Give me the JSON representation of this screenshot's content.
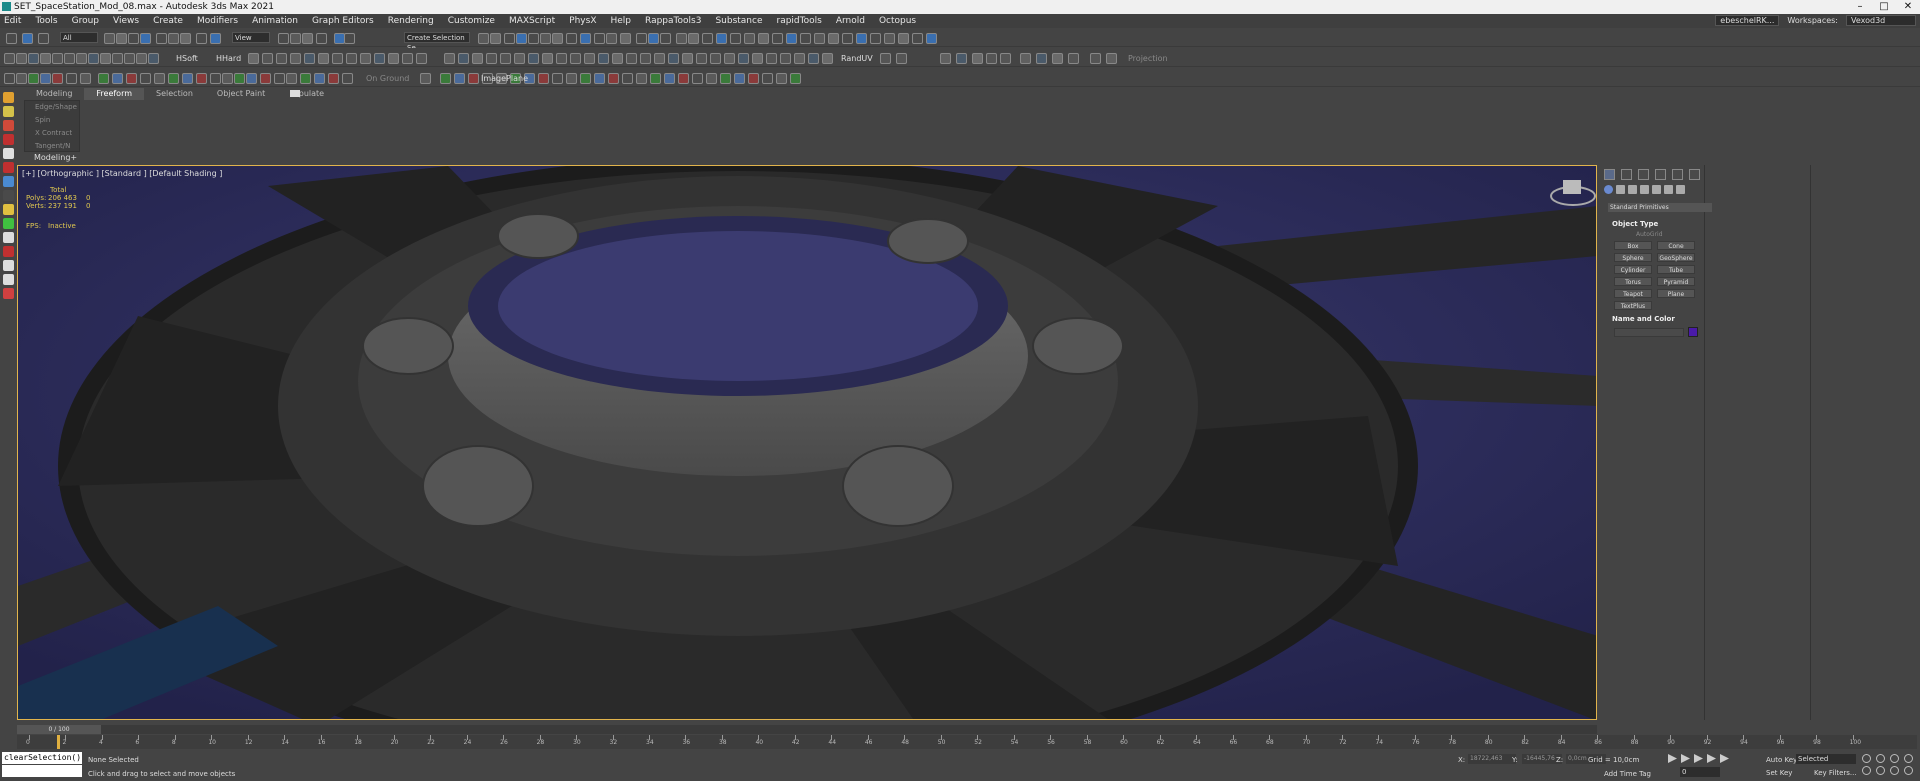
{
  "window": {
    "title": "SET_SpaceStation_Mod_08.max - Autodesk 3ds Max 2021",
    "minimize": "–",
    "maximize": "□",
    "close": "✕"
  },
  "menu": {
    "items": [
      "Edit",
      "Tools",
      "Group",
      "Views",
      "Create",
      "Modifiers",
      "Animation",
      "Graph Editors",
      "Rendering",
      "Customize",
      "MAXScript",
      "PhysX",
      "Help",
      "RappaTools3",
      "Substance",
      "rapidTools",
      "Arnold",
      "Octopus"
    ],
    "user": "ebeschelRK...",
    "workspaces_label": "Workspaces:",
    "workspace_value": "Vexod3d"
  },
  "toolbar1": {
    "filter": "All",
    "ref_coord": "View",
    "selection_set": "Create Selection Se"
  },
  "toolbar2": {
    "hsoft": "HSoft",
    "hhard": "HHard",
    "randuv": "RandUV",
    "projection": "Projection"
  },
  "toolbar3": {
    "on_ground": "On Ground",
    "image_plane": "ImagePlane"
  },
  "ribbon": {
    "tabs": [
      "Modeling",
      "Freeform",
      "Selection",
      "Object Paint",
      "Populate"
    ],
    "active_tab": "Freeform",
    "panel_items": [
      "Edge/Shape",
      "Spin",
      "X Contract",
      "Tangent/N"
    ],
    "footer": "Modeling+"
  },
  "viewport": {
    "label": "[+] [Orthographic ] [Standard ] [Default Shading ]",
    "stats": {
      "total_label": "Total",
      "polys_label": "Polys:",
      "polys_value": "206 463",
      "polys_sel": "0",
      "verts_label": "Verts:",
      "verts_value": "237 191",
      "verts_sel": "0",
      "fps_label": "FPS:",
      "fps_value": "Inactive"
    }
  },
  "command_panel": {
    "category": "Standard Primitives",
    "object_type_header": "Object Type",
    "autogrid": "AutoGrid",
    "primitives": [
      "Box",
      "Cone",
      "Sphere",
      "GeoSphere",
      "Cylinder",
      "Tube",
      "Torus",
      "Pyramid",
      "Teapot",
      "Plane",
      "TextPlus"
    ],
    "name_color_header": "Name and Color",
    "object_color": "#4a1aa8"
  },
  "timeline": {
    "frame_display": "0 / 100",
    "ticks": [
      "0",
      "2",
      "4",
      "6",
      "8",
      "10",
      "12",
      "14",
      "16",
      "18",
      "20",
      "22",
      "24",
      "26",
      "28",
      "30",
      "32",
      "34",
      "36",
      "38",
      "40",
      "42",
      "44",
      "46",
      "48",
      "50",
      "52",
      "54",
      "56",
      "58",
      "60",
      "62",
      "64",
      "66",
      "68",
      "70",
      "72",
      "74",
      "76",
      "78",
      "80",
      "82",
      "84",
      "86",
      "88",
      "90",
      "92",
      "94",
      "96",
      "98",
      "100"
    ]
  },
  "status": {
    "maxscript": "clearSelection()",
    "selection": "None Selected",
    "prompt": "Click and drag to select and move objects",
    "x_label": "X:",
    "x_value": "18722,463",
    "y_label": "Y:",
    "y_value": "-16445,76",
    "z_label": "Z:",
    "z_value": "0,0cm",
    "grid": "Grid = 10,0cm",
    "add_time_tag": "Add Time Tag",
    "auto_key": "Auto Key",
    "set_key": "Set Key",
    "key_mode": "Selected",
    "key_filters": "Key Filters...",
    "frame": "0"
  }
}
